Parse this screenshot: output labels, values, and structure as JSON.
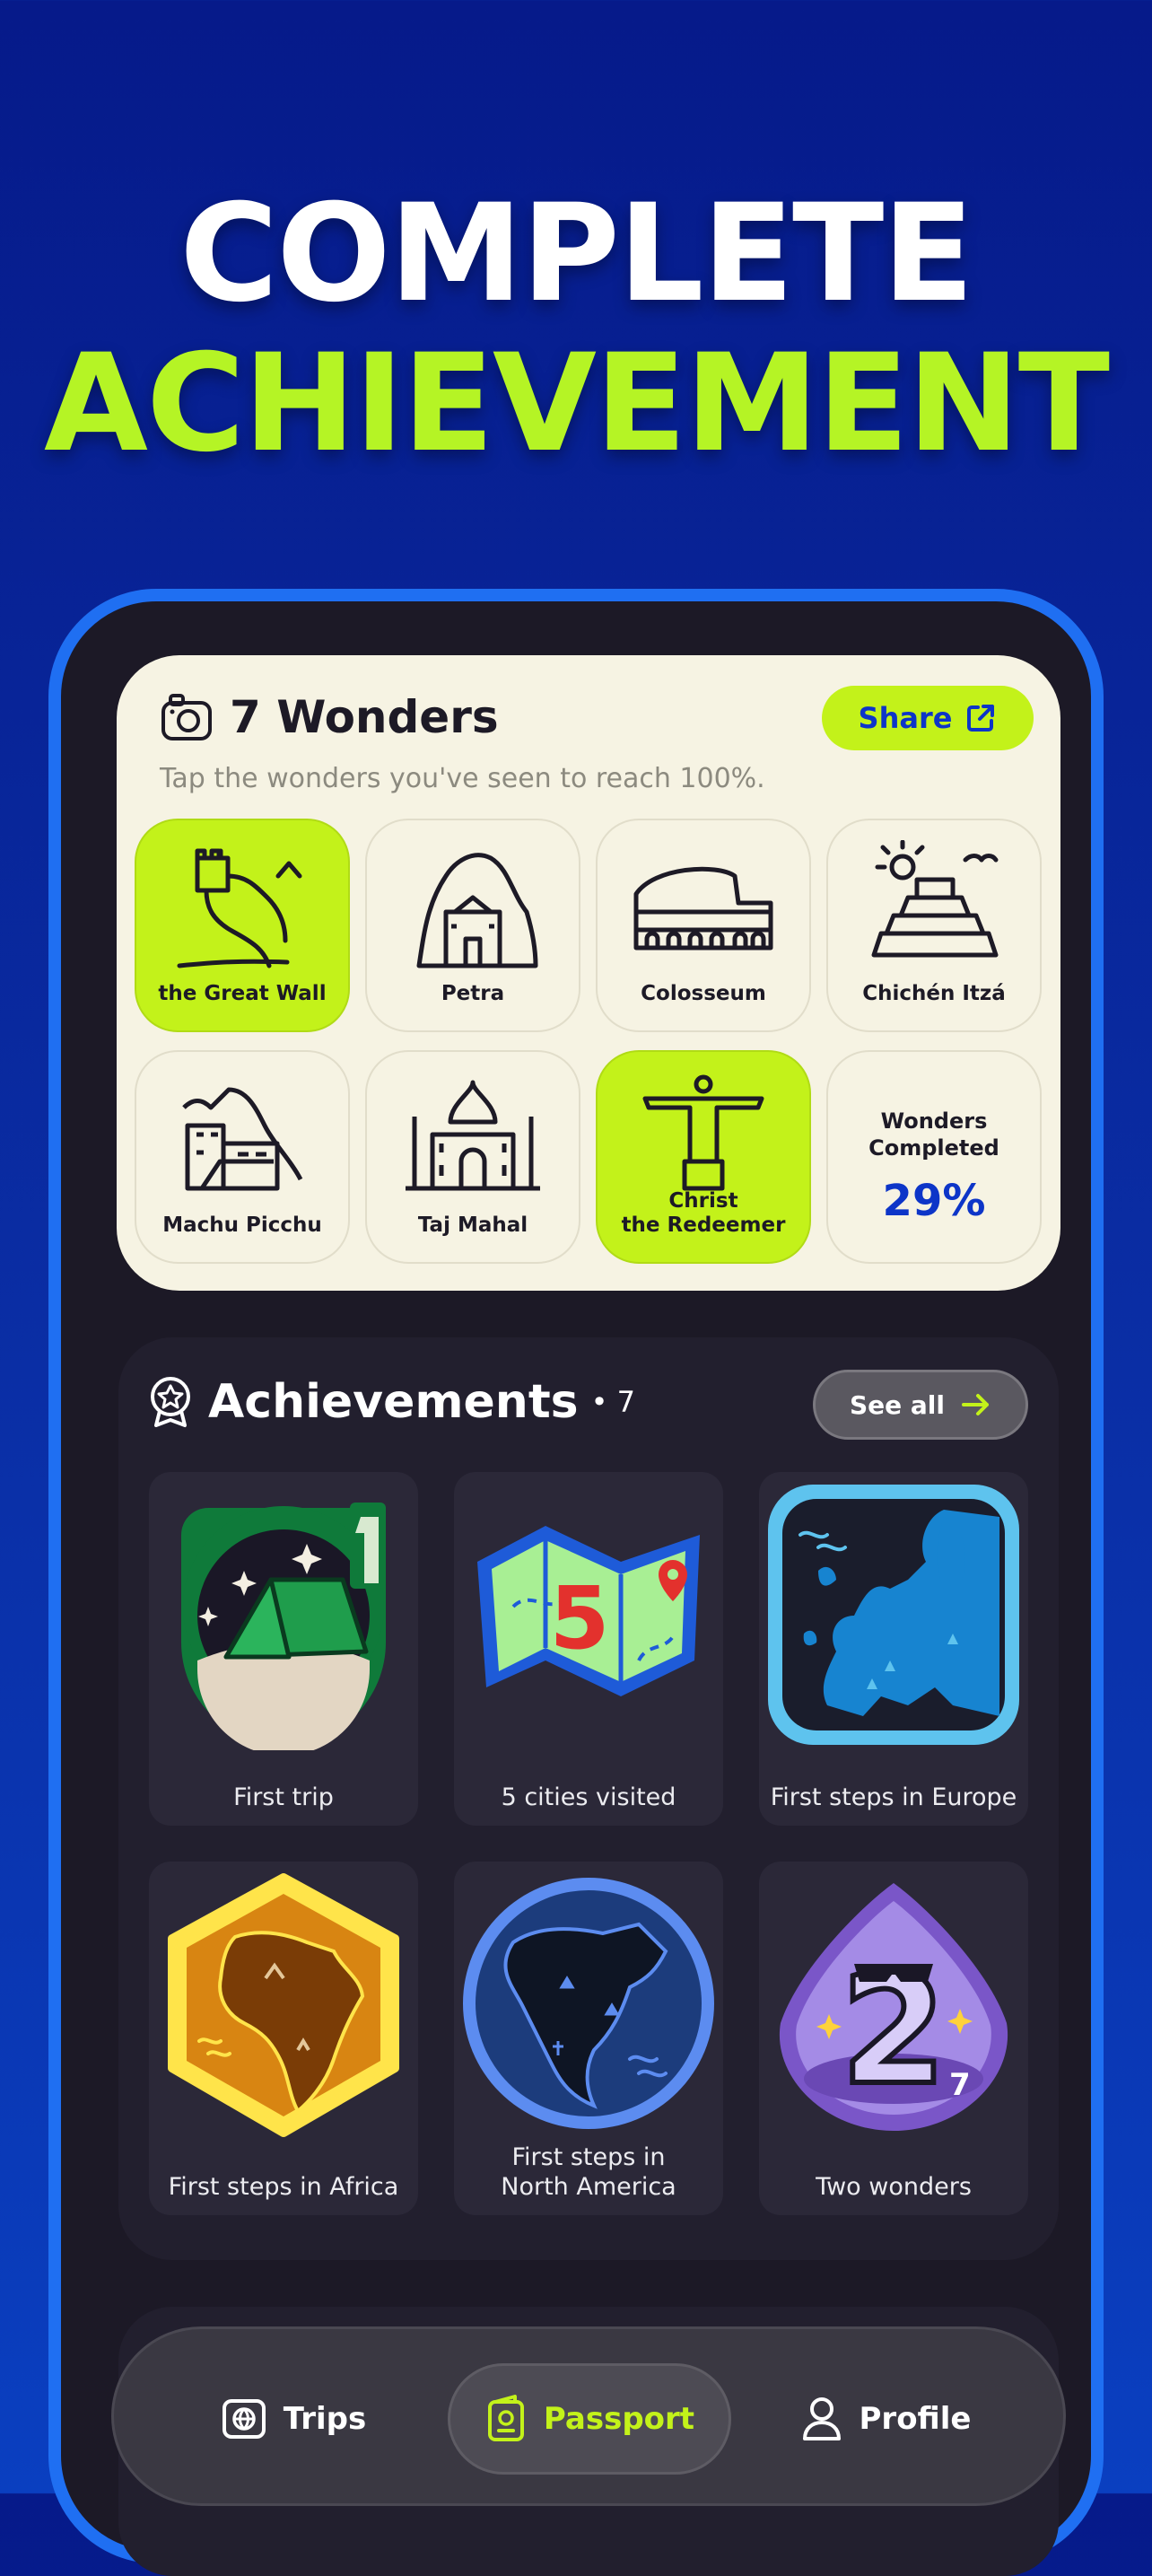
{
  "hero": {
    "line1": "COMPLETE",
    "line2": "ACHIEVEMENT"
  },
  "wonders": {
    "title": "7 Wonders",
    "share_label": "Share",
    "subtitle": "Tap the wonders you've seen to reach 100%.",
    "tiles": [
      {
        "label": "the Great Wall",
        "seen": true
      },
      {
        "label": "Petra",
        "seen": false
      },
      {
        "label": "Colosseum",
        "seen": false
      },
      {
        "label": "Chichén Itzá",
        "seen": false
      },
      {
        "label": "Machu Picchu",
        "seen": false
      },
      {
        "label": "Taj Mahal",
        "seen": false
      },
      {
        "label": "Christ\nthe Redeemer",
        "seen": true
      }
    ],
    "completed_label": "Wonders\nCompleted",
    "completed_value": "29%"
  },
  "achievements": {
    "title": "Achievements",
    "count": "• 7",
    "see_all_label": "See all",
    "badges": [
      {
        "label": "First trip",
        "icon": "tent-badge"
      },
      {
        "label": "5 cities visited",
        "icon": "map-5-badge"
      },
      {
        "label": "First steps in Europe",
        "icon": "europe-badge"
      },
      {
        "label": "First steps in Africa",
        "icon": "africa-badge"
      },
      {
        "label": "First steps in\nNorth America",
        "icon": "north-america-badge"
      },
      {
        "label": "Two wonders",
        "icon": "two-wonders-badge"
      }
    ]
  },
  "nav": {
    "items": [
      {
        "label": "Trips",
        "icon": "globe-ticket-icon",
        "active": false
      },
      {
        "label": "Passport",
        "icon": "passport-icon",
        "active": true
      },
      {
        "label": "Profile",
        "icon": "person-icon",
        "active": false
      }
    ]
  },
  "colors": {
    "accent": "#c3f21a",
    "primary_blue": "#0d35c8",
    "frame": "#1f6ff2"
  }
}
